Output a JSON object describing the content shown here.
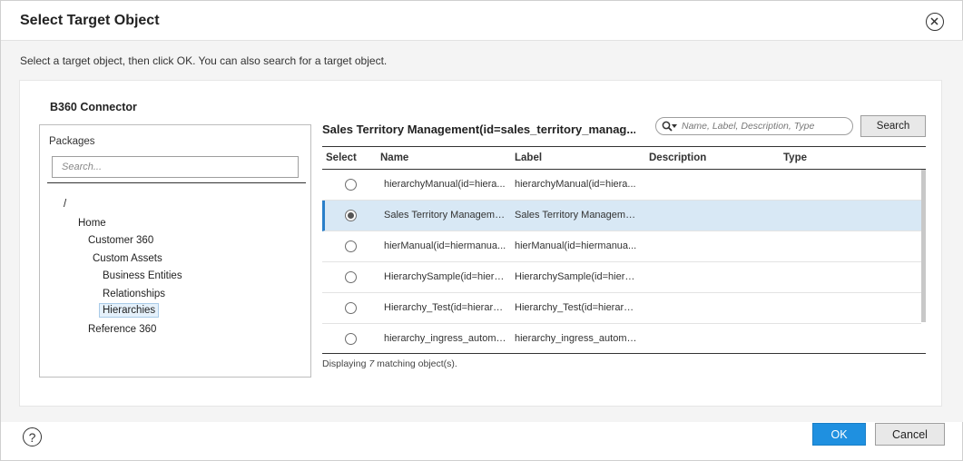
{
  "dialog": {
    "title": "Select Target Object",
    "instructions": "Select a target object, then click OK. You can also search for a target object."
  },
  "connector": {
    "title": "B360 Connector"
  },
  "packages": {
    "label": "Packages",
    "search_placeholder": "Search...",
    "tree": {
      "root": "/",
      "home": "Home",
      "customer360": "Customer 360",
      "custom_assets": "Custom Assets",
      "business_entities": "Business Entities",
      "relationships": "Relationships",
      "hierarchies": "Hierarchies",
      "reference360": "Reference 360"
    }
  },
  "objects": {
    "heading": "Sales Territory Management(id=sales_territory_manag...",
    "search_placeholder": "Name, Label, Description, Type",
    "search_button": "Search",
    "columns": {
      "select": "Select",
      "name": "Name",
      "label": "Label",
      "description": "Description",
      "type": "Type"
    },
    "rows": [
      {
        "name": "hierarchyManual(id=hiera...",
        "label": "hierarchyManual(id=hiera...",
        "selected": false
      },
      {
        "name": "Sales Territory Manageme...",
        "label": "Sales Territory Manageme...",
        "selected": true
      },
      {
        "name": "hierManual(id=hiermanua...",
        "label": "hierManual(id=hiermanua...",
        "selected": false
      },
      {
        "name": "HierarchySample(id=hiera...",
        "label": "HierarchySample(id=hiera...",
        "selected": false
      },
      {
        "name": "Hierarchy_Test(id=hierarch...",
        "label": "Hierarchy_Test(id=hierarch...",
        "selected": false
      },
      {
        "name": "hierarchy_ingress_automa...",
        "label": "hierarchy_ingress_automa...",
        "selected": false
      }
    ],
    "status_prefix": "Displaying",
    "status_count": "7",
    "status_suffix": "matching object(s)."
  },
  "footer": {
    "help": "?",
    "ok": "OK",
    "cancel": "Cancel"
  },
  "colors": {
    "primary": "#1f90e0",
    "selected_row": "#d8e8f5",
    "selected_accent": "#2a7fc9"
  }
}
